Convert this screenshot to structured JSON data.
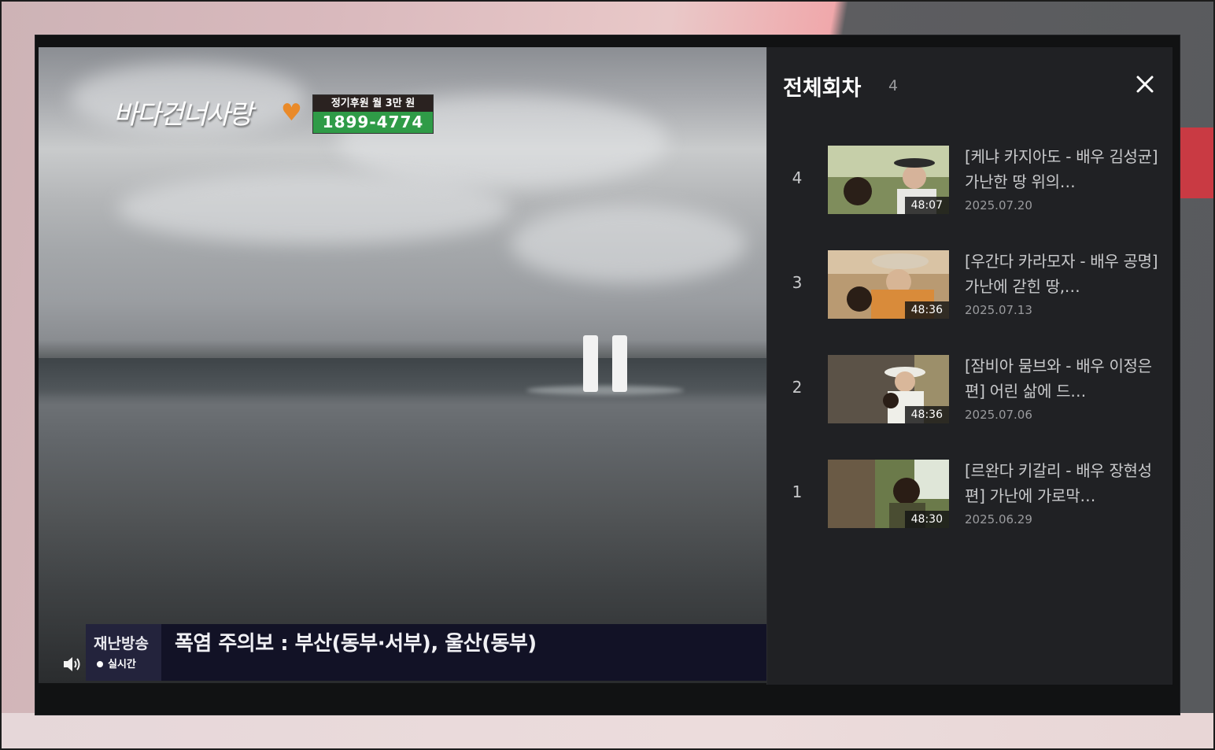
{
  "player": {
    "logo_text": "바다건너사랑",
    "donate_line1": "정기후원 월 3만 원",
    "donate_line2": "1899-4774",
    "ticker_label": "재난방송",
    "ticker_live": "실시간",
    "ticker_text": "폭염 주의보 : 부산(동부·서부), 울산(동부)",
    "pause_icon": "pause-icon",
    "volume_icon": "volume-icon"
  },
  "panel": {
    "title": "전체회차",
    "count": "4",
    "close_icon": "close-icon",
    "episodes": [
      {
        "num": "4",
        "title": "[케냐 카지아도 - 배우 김성균] 가난한 땅 위의…",
        "date": "2025.07.20",
        "duration": "48:07",
        "thumb_color": "#6d7a4a"
      },
      {
        "num": "3",
        "title": "[우간다 카라모자 - 배우 공명] 가난에 갇힌 땅,…",
        "date": "2025.07.13",
        "duration": "48:36",
        "thumb_color": "#a7825a"
      },
      {
        "num": "2",
        "title": "[잠비아 뭄브와 - 배우 이정은 편] 어린 삶에 드…",
        "date": "2025.07.06",
        "duration": "48:36",
        "thumb_color": "#5e5548"
      },
      {
        "num": "1",
        "title": "[르완다 키갈리 - 배우 장현성 편] 가난에 가로막…",
        "date": "2025.06.29",
        "duration": "48:30",
        "thumb_color": "#4c5e36"
      }
    ]
  }
}
